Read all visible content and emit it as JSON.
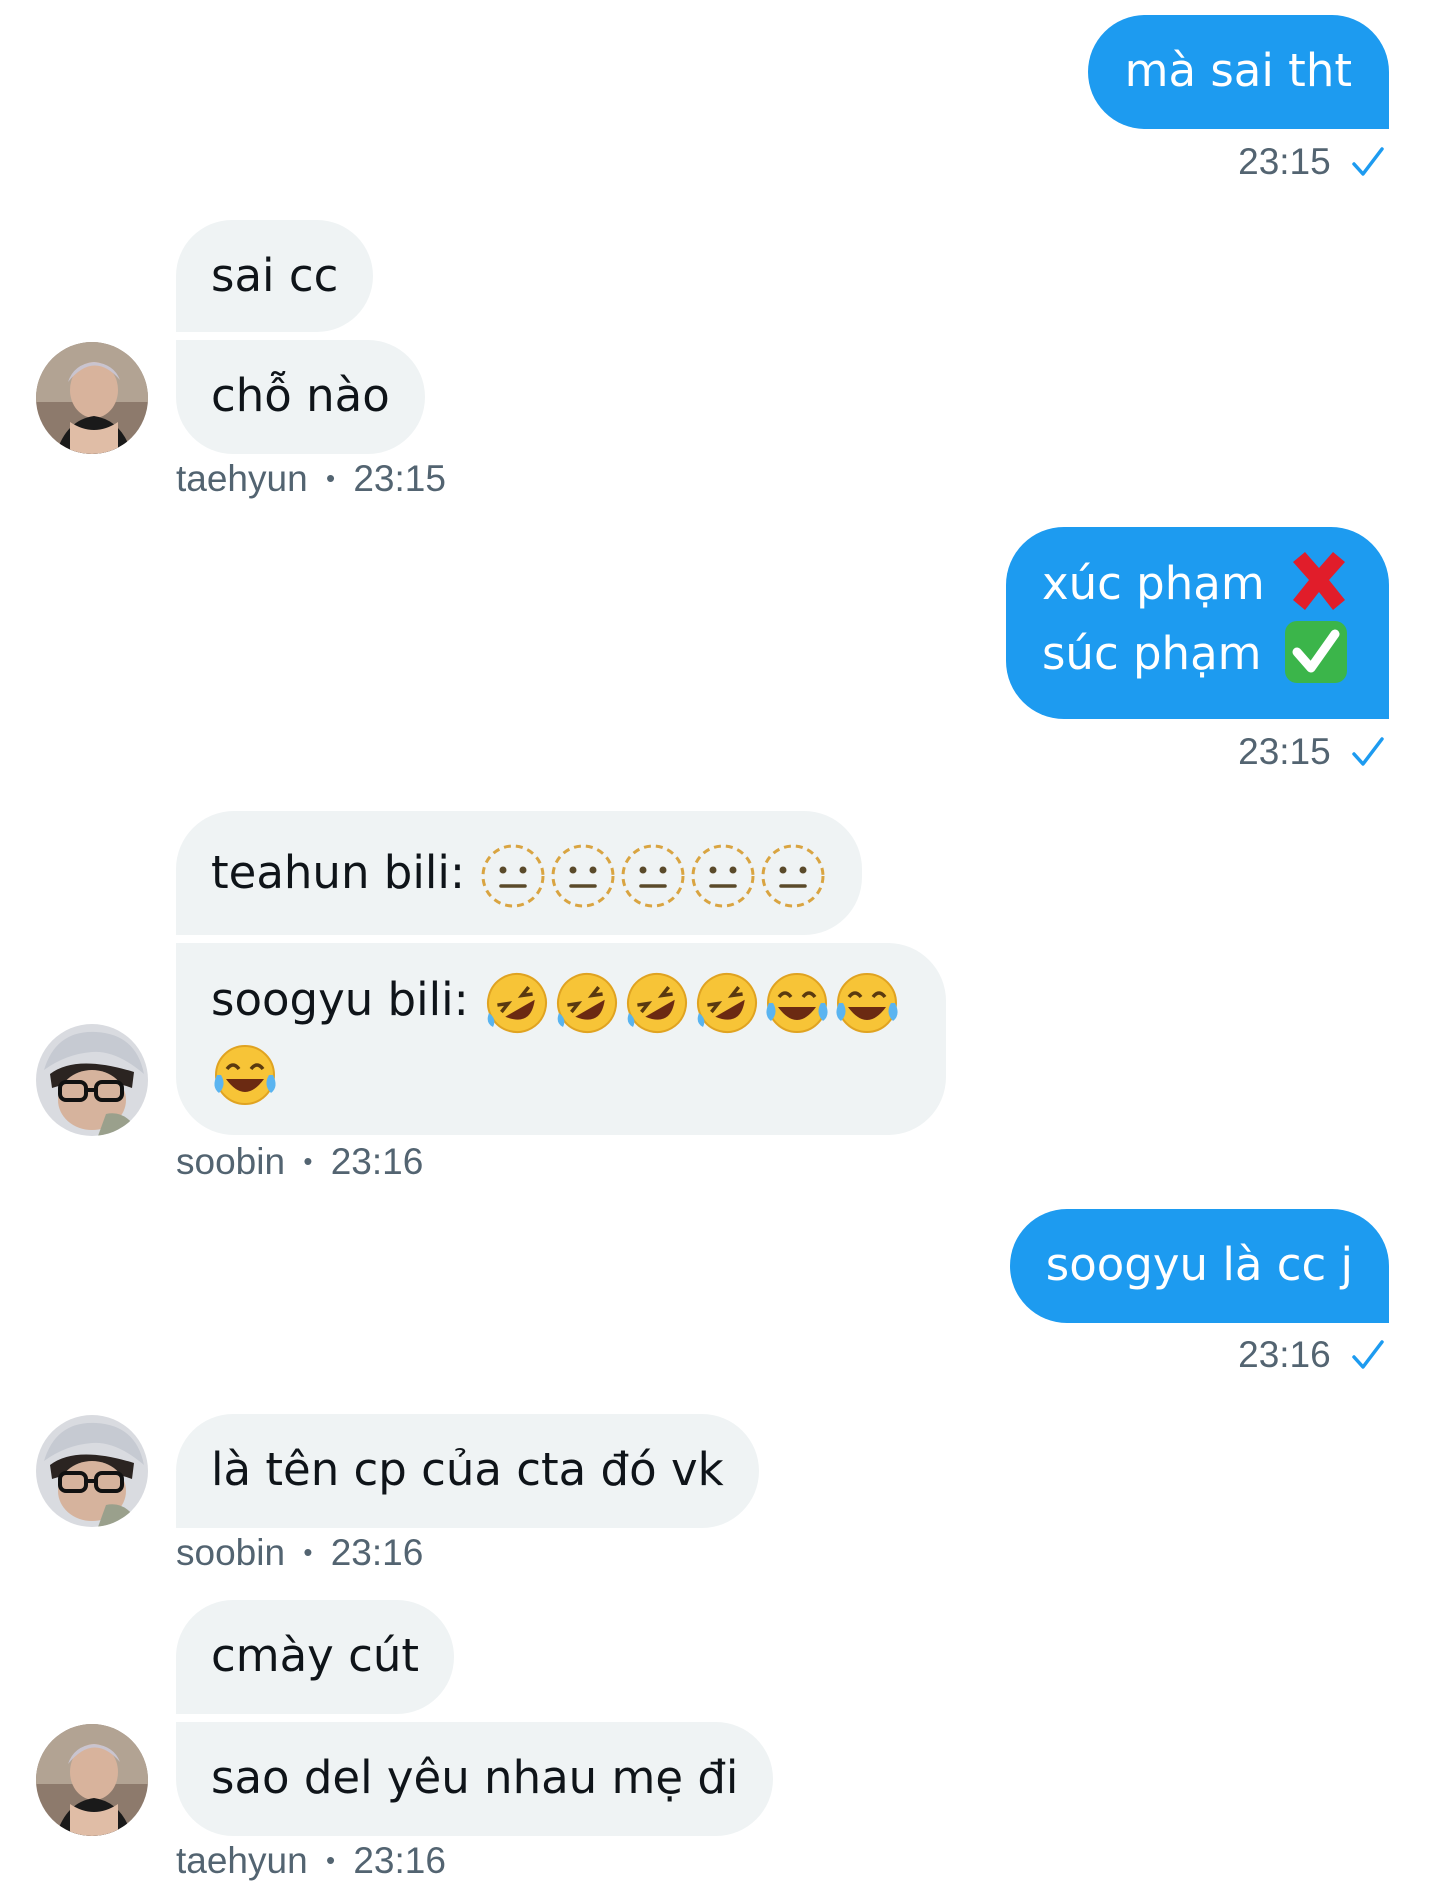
{
  "colors": {
    "outgoing_bubble": "#1d9bf0",
    "incoming_bubble": "#eff3f4",
    "meta_text": "#536471",
    "read_tick": "#1d9bf0"
  },
  "messages": [
    {
      "direction": "outgoing",
      "text": "mà sai tht",
      "time": "23:15"
    },
    {
      "direction": "incoming",
      "lines": [
        "sai cc",
        "chỗ nào"
      ],
      "sender": "taehyun",
      "time": "23:15"
    },
    {
      "direction": "outgoing",
      "lines": [
        "xúc phạm",
        "súc phạm"
      ],
      "line_emojis": [
        "cross-mark",
        "check-mark-button"
      ],
      "time": "23:15"
    },
    {
      "direction": "incoming",
      "lines": [
        "teahun bili:",
        "soogyu bili:"
      ],
      "line_emojis": [
        "dotted-line-face ×5",
        "rolling-on-the-floor-laughing ×4, face-with-tears-of-joy ×3"
      ],
      "sender": "soobin",
      "time": "23:16"
    },
    {
      "direction": "outgoing",
      "text": "soogyu là cc j",
      "time": "23:16"
    },
    {
      "direction": "incoming",
      "text": "là tên cp của cta đó vk",
      "sender": "soobin",
      "time": "23:16"
    },
    {
      "direction": "incoming",
      "lines": [
        "cmày cút",
        "sao del yêu nhau mẹ đi"
      ],
      "sender": "taehyun",
      "time": "23:16"
    }
  ],
  "separator": "•"
}
